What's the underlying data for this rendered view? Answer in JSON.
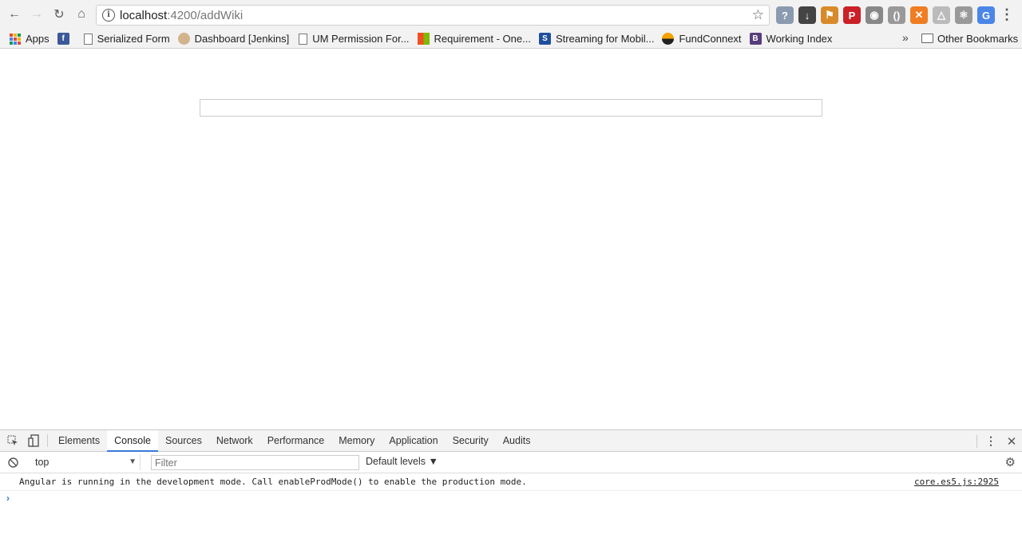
{
  "browser": {
    "url_host": "localhost",
    "url_rest": ":4200/addWiki",
    "nav": {
      "back": "←",
      "forward": "→",
      "reload": "↻",
      "home": "⌂"
    },
    "extensions": [
      {
        "name": "translate-badge-icon",
        "color": "#8a9bb0",
        "glyph": "?"
      },
      {
        "name": "download-icon",
        "color": "#444444",
        "glyph": "↓"
      },
      {
        "name": "flag-icon",
        "color": "#d88a2a",
        "glyph": "⚑"
      },
      {
        "name": "pinterest-icon",
        "color": "#cb2027",
        "glyph": "P"
      },
      {
        "name": "camera-icon",
        "color": "#888888",
        "glyph": "◉"
      },
      {
        "name": "code-icon",
        "color": "#999999",
        "glyph": "()"
      },
      {
        "name": "orange-circle-icon",
        "color": "#f07d22",
        "glyph": "✕"
      },
      {
        "name": "triangle-icon",
        "color": "#bbbbbb",
        "glyph": "△"
      },
      {
        "name": "react-icon",
        "color": "#999999",
        "glyph": "⚛"
      },
      {
        "name": "google-translate-icon",
        "color": "#4a85e8",
        "glyph": "G"
      }
    ]
  },
  "bookmarks": {
    "items": [
      {
        "name": "bookmark-apps",
        "label": "Apps",
        "icon": "apps"
      },
      {
        "name": "bookmark-facebook",
        "label": "",
        "icon": "facebook"
      },
      {
        "name": "bookmark-serialized-form",
        "label": "Serialized Form",
        "icon": "page"
      },
      {
        "name": "bookmark-dashboard-jenkins",
        "label": "Dashboard [Jenkins]",
        "icon": "jenkins"
      },
      {
        "name": "bookmark-um-permission",
        "label": "UM Permission For...",
        "icon": "page"
      },
      {
        "name": "bookmark-requirement",
        "label": "Requirement - One...",
        "icon": "ms"
      },
      {
        "name": "bookmark-streaming",
        "label": "Streaming for Mobil...",
        "icon": "streaming"
      },
      {
        "name": "bookmark-fundconnext",
        "label": "FundConnext",
        "icon": "fund"
      },
      {
        "name": "bookmark-working-index",
        "label": "Working Index",
        "icon": "bootstrap"
      }
    ],
    "more": "»",
    "other": "Other Bookmarks"
  },
  "page": {
    "input_value": ""
  },
  "devtools": {
    "tabs": [
      "Elements",
      "Console",
      "Sources",
      "Network",
      "Performance",
      "Memory",
      "Application",
      "Security",
      "Audits"
    ],
    "active_tab": "Console",
    "context": "top",
    "filter_placeholder": "Filter",
    "levels": "Default levels ▼",
    "message": "Angular is running in the development mode. Call enableProdMode() to enable the production mode.",
    "message_source": "core.es5.js:2925",
    "prompt": "›"
  }
}
